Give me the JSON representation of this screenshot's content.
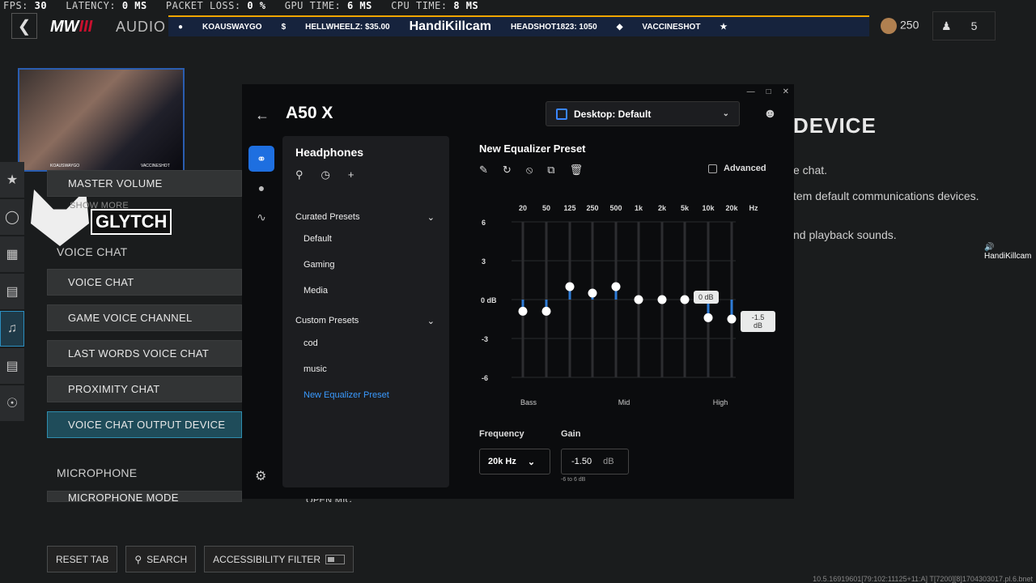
{
  "stats": {
    "fps_label": "FPS:",
    "fps": "30",
    "latency_label": "LATENCY:",
    "latency": "0 MS",
    "packet_label": "PACKET LOSS:",
    "packet": "0 %",
    "gpu_label": "GPU TIME:",
    "gpu": "6 MS",
    "cpu_label": "CPU TIME:",
    "cpu": "8 MS"
  },
  "game": {
    "logo_a": "MW",
    "logo_b": "III",
    "section_title": "AUDIO",
    "ticker": {
      "p1": "KOAUSWAYGO",
      "p2": "HELLWHEELZ: $35.00",
      "p3": "HandiKillcam",
      "p4": "HEADSHOT1823: 1050",
      "p5": "VACCINESHOT"
    },
    "coins": "250",
    "party_count": "5",
    "cam_left": "KOAUSWAYGO",
    "cam_right": "VACCINESHOT",
    "brand": "GLYTCH",
    "menu": {
      "master_volume": "MASTER VOLUME",
      "show_more": "SHOW MORE",
      "voice_chat_header": "VOICE CHAT",
      "voice_chat": "VOICE CHAT",
      "game_voice_channel": "GAME VOICE CHANNEL",
      "last_words": "LAST WORDS VOICE CHAT",
      "proximity": "PROXIMITY CHAT",
      "output_device": "VOICE CHAT OUTPUT DEVICE",
      "microphone_header": "MICROPHONE",
      "mic_mode": "MICROPHONE MODE",
      "mic_mode_value": "OPEN MIC"
    },
    "right": {
      "title": "DEVICE",
      "line1": "e chat.",
      "line2": "tem default communications devices.",
      "line3": "nd playback sounds.",
      "speaker": "HandiKillcam"
    },
    "bottom": {
      "reset": "RESET TAB",
      "search": "SEARCH",
      "accessibility": "ACCESSIBILITY FILTER"
    },
    "version": "10.5.16919601[79:102:11125+11:A] T[7200][8]1704303017.pl.6.bnet"
  },
  "ghub": {
    "device": "A50 X",
    "profile": "Desktop: Default",
    "panel_title": "Headphones",
    "curated_header": "Curated Presets",
    "curated": [
      "Default",
      "Gaming",
      "Media"
    ],
    "custom_header": "Custom Presets",
    "custom": [
      "cod",
      "music",
      "New Equalizer Preset"
    ],
    "eq_title": "New Equalizer Preset",
    "advanced": "Advanced",
    "freq_labels": [
      "20",
      "50",
      "125",
      "250",
      "500",
      "1k",
      "2k",
      "5k",
      "10k",
      "20k"
    ],
    "hz": "Hz",
    "db_labels": [
      "6",
      "3",
      "0 dB",
      "-3",
      "-6"
    ],
    "range_labels": [
      "Bass",
      "Mid",
      "High"
    ],
    "gains_db": [
      -0.9,
      -0.9,
      1.0,
      0.5,
      1.0,
      0,
      0,
      0,
      -1.4,
      -1.5
    ],
    "tip_hover": "0 dB",
    "tip_active_a": "-1.5",
    "tip_active_b": "dB",
    "frequency_label": "Frequency",
    "frequency_value": "20k Hz",
    "gain_label": "Gain",
    "gain_value": "-1.50",
    "gain_unit": "dB",
    "gain_range": "-6 to 6 dB",
    "accent": "#2e7bd6"
  }
}
